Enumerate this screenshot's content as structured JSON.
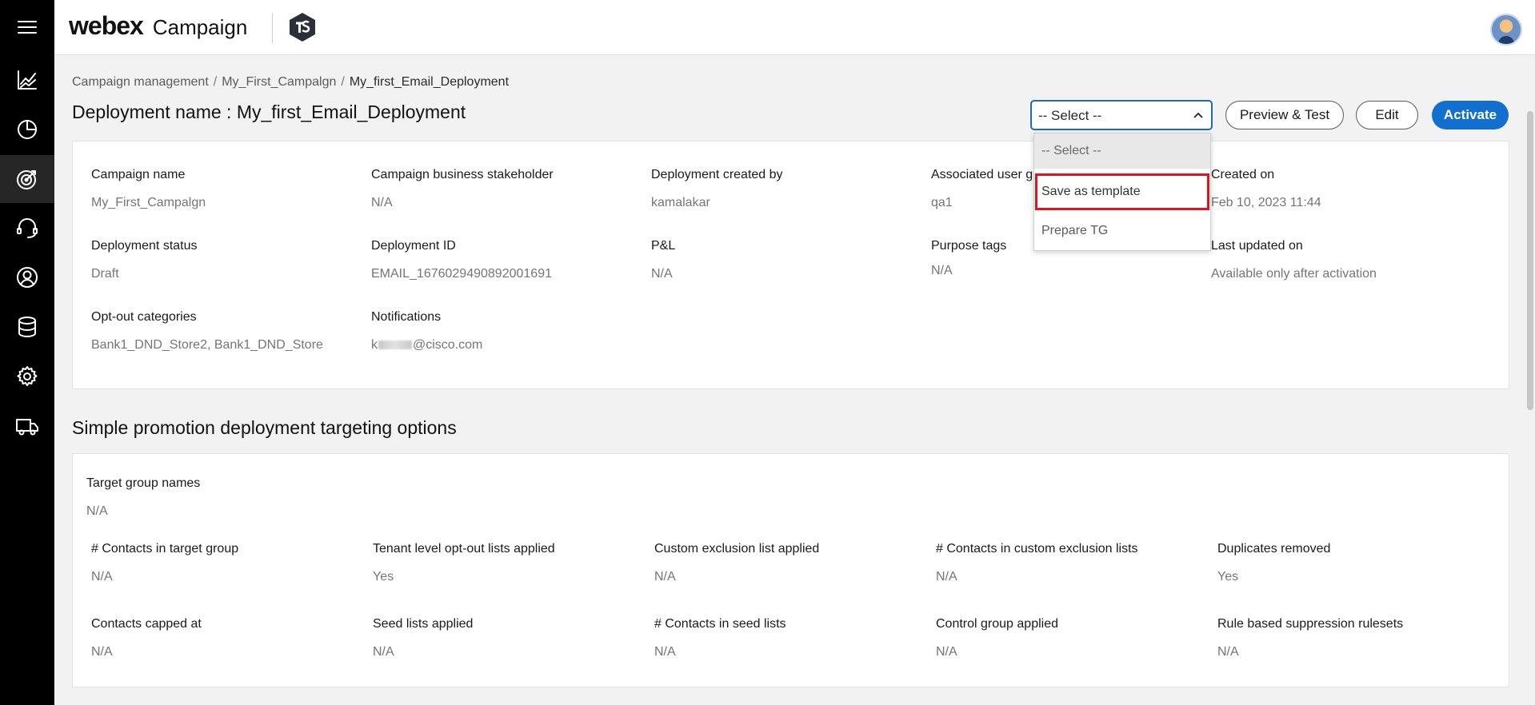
{
  "app": {
    "brand_primary": "webex",
    "brand_secondary": "Campaign"
  },
  "nav": {
    "items": [
      {
        "name": "analytics",
        "icon": "line-chart-icon"
      },
      {
        "name": "reports",
        "icon": "pie-chart-icon"
      },
      {
        "name": "campaigns",
        "icon": "target-icon",
        "active": true
      },
      {
        "name": "support",
        "icon": "headset-icon"
      },
      {
        "name": "contacts",
        "icon": "user-circle-icon"
      },
      {
        "name": "data",
        "icon": "database-icon"
      },
      {
        "name": "settings",
        "icon": "gear-icon"
      },
      {
        "name": "delivery",
        "icon": "truck-icon"
      }
    ]
  },
  "breadcrumb": [
    "Campaign management",
    "My_First_Campalgn",
    "My_first_Email_Deployment"
  ],
  "title": "Deployment name : My_first_Email_Deployment",
  "actions": {
    "select_value": "-- Select --",
    "preview": "Preview & Test",
    "edit": "Edit",
    "activate": "Activate"
  },
  "dropdown": {
    "options": [
      "-- Select --",
      "Save as template",
      "Prepare TG"
    ],
    "highlighted": "Save as template"
  },
  "details": {
    "campaign_name": {
      "label": "Campaign name",
      "value": "My_First_Campalgn"
    },
    "stakeholder": {
      "label": "Campaign business stakeholder",
      "value": "N/A"
    },
    "created_by": {
      "label": "Deployment created by",
      "value": "kamalakar"
    },
    "user_group": {
      "label": "Associated user g",
      "value": "qa1"
    },
    "created_on": {
      "label": "Created on",
      "value": "Feb 10, 2023 11:44"
    },
    "status": {
      "label": "Deployment status",
      "value": "Draft"
    },
    "deployment_id": {
      "label": "Deployment ID",
      "value": "EMAIL_1676029490892001691"
    },
    "pnl": {
      "label": "P&L",
      "value": "N/A"
    },
    "purpose_tags": {
      "label": "Purpose tags",
      "value": "N/A"
    },
    "last_updated": {
      "label": "Last updated on",
      "value": "Available only after activation"
    },
    "optout": {
      "label": "Opt-out categories",
      "value": "Bank1_DND_Store2, Bank1_DND_Store"
    },
    "notifications": {
      "label": "Notifications",
      "value_prefix": "k",
      "value_suffix": "@cisco.com"
    }
  },
  "targeting": {
    "section_title": "Simple promotion deployment targeting options",
    "target_groups": {
      "label": "Target group names",
      "value": "N/A"
    },
    "contacts_in_tg": {
      "label": "# Contacts in target group",
      "value": "N/A"
    },
    "tenant_optout": {
      "label": "Tenant level opt-out lists applied",
      "value": "Yes"
    },
    "custom_exclusion": {
      "label": "Custom exclusion list applied",
      "value": "N/A"
    },
    "contacts_custom_excl": {
      "label": "# Contacts in custom exclusion lists",
      "value": "N/A"
    },
    "duplicates": {
      "label": "Duplicates removed",
      "value": "Yes"
    },
    "capped_at": {
      "label": "Contacts capped at",
      "value": "N/A"
    },
    "seed_lists": {
      "label": "Seed lists applied",
      "value": "N/A"
    },
    "contacts_seed": {
      "label": "# Contacts in seed lists",
      "value": "N/A"
    },
    "control_group": {
      "label": "Control group applied",
      "value": "N/A"
    },
    "suppression": {
      "label": "Rule based suppression rulesets",
      "value": "N/A"
    }
  },
  "colors": {
    "accent": "#1170cf",
    "highlight": "#e0141e",
    "nav_bg": "#000000"
  }
}
